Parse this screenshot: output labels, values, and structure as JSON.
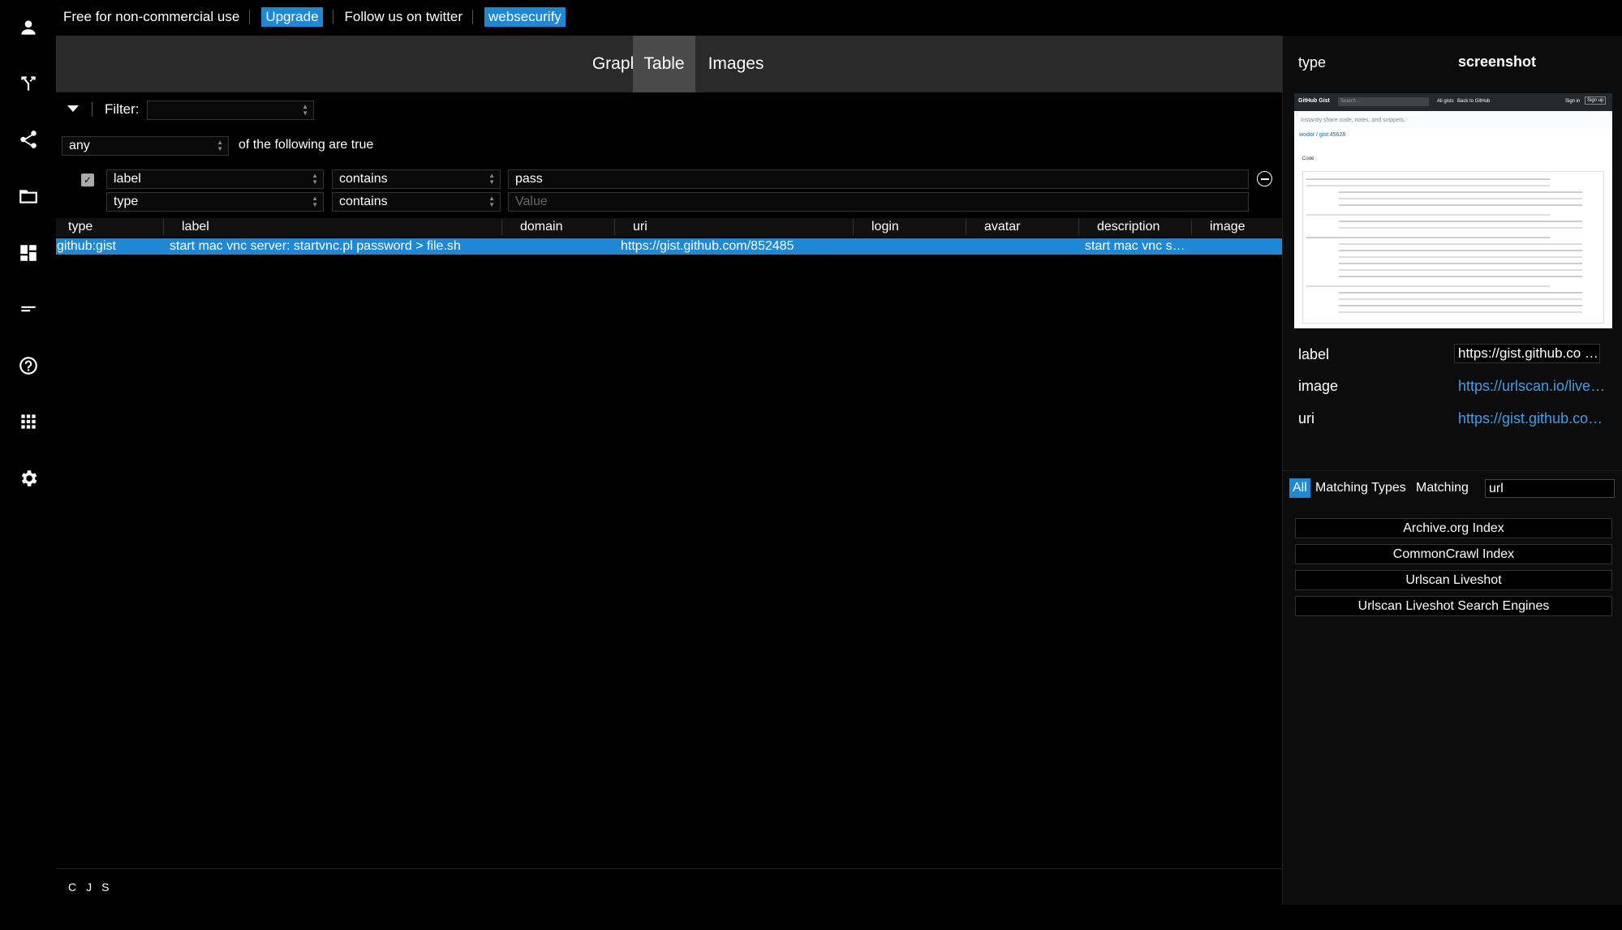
{
  "sidebar": {
    "items": [
      {
        "icon": "person-icon",
        "name": "sidebar-profile"
      },
      {
        "icon": "merge-icon",
        "name": "sidebar-transforms"
      },
      {
        "icon": "share-icon",
        "name": "sidebar-share"
      },
      {
        "icon": "folder-icon",
        "name": "sidebar-folder"
      },
      {
        "icon": "dashboard-icon",
        "name": "sidebar-dashboard"
      },
      {
        "icon": "short-text-icon",
        "name": "sidebar-text"
      },
      {
        "icon": "help-icon",
        "name": "sidebar-help"
      },
      {
        "icon": "apps-icon",
        "name": "sidebar-apps"
      },
      {
        "icon": "gear-icon",
        "name": "sidebar-settings"
      }
    ]
  },
  "topbar": {
    "license_text": "Free for non-commercial use",
    "upgrade_label": "Upgrade",
    "follow_text": "Follow us on twitter",
    "twitter_label": "websecurify"
  },
  "tabs": [
    "Graph",
    "Table",
    "Images"
  ],
  "active_tab": "Table",
  "filter": {
    "label": "Filter:",
    "value": "",
    "match_mode": "any",
    "match_suffix": "of the following are true",
    "rules": [
      {
        "field": "label",
        "operator": "contains",
        "value": "pass",
        "placeholder": ""
      },
      {
        "field": "type",
        "operator": "contains",
        "value": "",
        "placeholder": "Value"
      }
    ]
  },
  "table": {
    "columns": [
      "type",
      "label",
      "domain",
      "uri",
      "login",
      "avatar",
      "description",
      "image"
    ],
    "rows": [
      {
        "type": "github:gist",
        "label": "start mac vnc server: startvnc.pl password > file.sh",
        "domain": "",
        "uri": "https://gist.github.com/852485",
        "login": "",
        "avatar": "",
        "description": "start mac vnc s…",
        "image": ""
      }
    ]
  },
  "footer": {
    "letters": [
      "C",
      "J",
      "S"
    ]
  },
  "details": {
    "type_key": "type",
    "type_value": "screenshot",
    "fields": [
      {
        "key": "label",
        "value": "https://gist.github.co …"
      },
      {
        "key": "image",
        "value": "https://urlscan.io/live…"
      },
      {
        "key": "uri",
        "value": "https://gist.github.co…"
      }
    ],
    "preview": {
      "brand": "GitHub Gist",
      "search_placeholder": "Search…",
      "nav": [
        "All gists",
        "Back to GitHub"
      ],
      "auth": [
        "Sign in",
        "Sign up"
      ],
      "tagline": "Instantly share code, notes, and snippets.",
      "title": "wodor / gist:45628",
      "file_tab": "Code"
    }
  },
  "transforms": {
    "filters": [
      "All",
      "Matching Types",
      "Matching ."
    ],
    "active_filter": "All",
    "search_value": "url",
    "items": [
      "Archive.org Index",
      "CommonCrawl Index",
      "Urlscan Liveshot",
      "Urlscan Liveshot Search Engines"
    ]
  },
  "colors": {
    "accent": "#1e88d4",
    "link": "#3aa0ea",
    "background": "#000000",
    "tab_active": "#4a4a4a"
  }
}
